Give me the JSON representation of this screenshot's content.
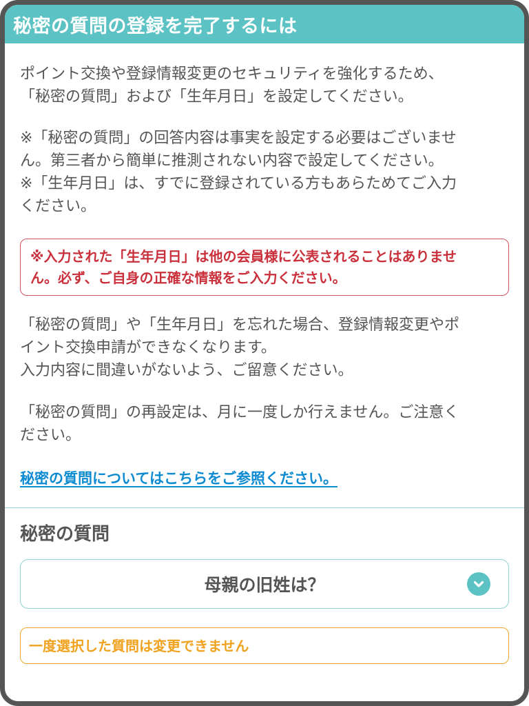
{
  "header": {
    "title": "秘密の質問の登録を完了するには"
  },
  "intro": {
    "lines": [
      "ポイント交換や登録情報変更のセキュリティを強化するため、",
      "「秘密の質問」および「生年月日」を設定してください。"
    ]
  },
  "notes": {
    "lines": [
      "※「秘密の質問」の回答内容は事実を設定する必要はございませ",
      "ん。第三者から簡単に推測されない内容で設定してください。",
      "※「生年月日」は、すでに登録されている方もあらためてご入力",
      "ください。"
    ]
  },
  "warning": {
    "lines": [
      "※入力された「生年月日」は他の会員様に公表されることはありませ",
      "ん。必ず、ご自身の正確な情報をご入力ください。"
    ]
  },
  "forgot": {
    "lines": [
      "「秘密の質問」や「生年月日」を忘れた場合、登録情報変更やポ",
      "イント交換申請ができなくなります。",
      "入力内容に間違いがないよう、ご留意ください。"
    ]
  },
  "reset_note": {
    "lines": [
      "「秘密の質問」の再設定は、月に一度しか行えません。ご注意く",
      "ださい。"
    ]
  },
  "link": {
    "label": "秘密の質問についてはこちらをご参照ください。"
  },
  "secret_question": {
    "section_title": "秘密の質問",
    "selected_value": "母親の旧姓は？",
    "notice": "一度選択した質問は変更できません"
  },
  "icons": {
    "dropdown": "chevron-down-icon"
  },
  "colors": {
    "header_bg": "#5cc2c4",
    "text": "#555555",
    "warning_red": "#c9303b",
    "link_blue": "#0d8bd2",
    "notice_orange": "#f0a11d",
    "border_teal": "#8fd2d4"
  }
}
